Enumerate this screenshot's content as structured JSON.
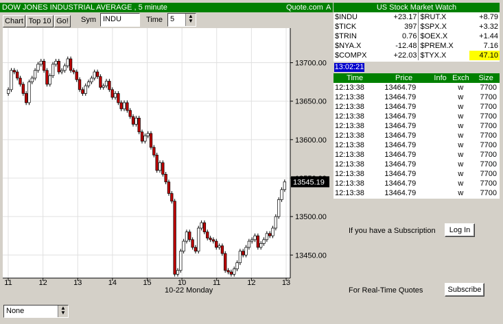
{
  "colors": {
    "green": "#008000",
    "up": "#ffffff",
    "down": "#c00000",
    "highlight": "#ffff00",
    "time_bg": "#0000cc"
  },
  "chart_header": {
    "title": "DOW JONES INDUSTRIAL AVERAGE  , 5 minute",
    "source": "Quote.com",
    "corner": "A"
  },
  "toolbar": {
    "chart": "Chart",
    "top10": "Top 10",
    "go": "Go!",
    "sym_label": "Sym",
    "sym_value": "INDU",
    "time_label": "Time",
    "time_value": "5"
  },
  "bottom_select": {
    "value": "None"
  },
  "watch": {
    "title": "US Stock Market Watch",
    "rows": [
      {
        "s1": "$INDU",
        "v1": "+23.17",
        "s2": "$RUT.X",
        "v2": "+8.79"
      },
      {
        "s1": "$TICK",
        "v1": "397",
        "s2": "$SPX.X",
        "v2": "+3.32"
      },
      {
        "s1": "$TRIN",
        "v1": "0.76",
        "s2": "$OEX.X",
        "v2": "+1.44"
      },
      {
        "s1": "$NYA.X",
        "v1": "-12.48",
        "s2": "$PREM.X",
        "v2": "7.16"
      },
      {
        "s1": "$COMPX",
        "v1": "+22.03",
        "s2": "$TYX.X",
        "v2": "47.10"
      }
    ]
  },
  "clock": "13:02:21",
  "trades": {
    "headers": [
      "Time",
      "Price",
      "Info",
      "Exch",
      "Size"
    ],
    "rows": [
      [
        "12:13:38",
        "13464.79",
        "",
        "w",
        "7700"
      ],
      [
        "12:13:38",
        "13464.79",
        "",
        "w",
        "7700"
      ],
      [
        "12:13:38",
        "13464.79",
        "",
        "w",
        "7700"
      ],
      [
        "12:13:38",
        "13464.79",
        "",
        "w",
        "7700"
      ],
      [
        "12:13:38",
        "13464.79",
        "",
        "w",
        "7700"
      ],
      [
        "12:13:38",
        "13464.79",
        "",
        "w",
        "7700"
      ],
      [
        "12:13:38",
        "13464.79",
        "",
        "w",
        "7700"
      ],
      [
        "12:13:38",
        "13464.79",
        "",
        "w",
        "7700"
      ],
      [
        "12:13:38",
        "13464.79",
        "",
        "w",
        "7700"
      ],
      [
        "12:13:38",
        "13464.79",
        "",
        "w",
        "7700"
      ],
      [
        "12:13:38",
        "13464.79",
        "",
        "w",
        "7700"
      ],
      [
        "12:13:38",
        "13464.79",
        "",
        "w",
        "7700"
      ]
    ]
  },
  "login": {
    "text": "If you have a Subscription",
    "button": "Log In"
  },
  "subscribe": {
    "text": "For Real-Time Quotes",
    "button": "Subscribe"
  },
  "chart_data": {
    "type": "candlestick",
    "y_ticks": [
      "13700.00",
      "13650.00",
      "13600.00",
      "13550.00",
      "13500.00",
      "13450.00"
    ],
    "y_tick_values": [
      13700,
      13650,
      13600,
      13550,
      13500,
      13450
    ],
    "ylim": [
      13420,
      13745
    ],
    "x_ticks": [
      "11",
      "12",
      "13",
      "14",
      "15",
      "10",
      "11",
      "12",
      "13"
    ],
    "x_label": "10-22 Monday",
    "last_price": "13545.19",
    "last_value": 13545.19,
    "closes": [
      13665,
      13690,
      13688,
      13680,
      13672,
      13660,
      13648,
      13675,
      13680,
      13690,
      13698,
      13702,
      13690,
      13672,
      13683,
      13698,
      13702,
      13688,
      13690,
      13696,
      13705,
      13690,
      13688,
      13678,
      13665,
      13660,
      13670,
      13675,
      13680,
      13688,
      13682,
      13668,
      13670,
      13676,
      13665,
      13655,
      13660,
      13648,
      13640,
      13648,
      13638,
      13630,
      13620,
      13628,
      13610,
      13598,
      13605,
      13608,
      13590,
      13580,
      13560,
      13570,
      13555,
      13545,
      13530,
      13520,
      13425,
      13430,
      13455,
      13468,
      13480,
      13470,
      13460,
      13455,
      13485,
      13492,
      13480,
      13472,
      13470,
      13468,
      13460,
      13462,
      13452,
      13430,
      13428,
      13425,
      13432,
      13440,
      13455,
      13450,
      13460,
      13468,
      13470,
      13475,
      13460,
      13465,
      13470,
      13478,
      13475,
      13485,
      13500,
      13522,
      13535,
      13545.19
    ]
  }
}
